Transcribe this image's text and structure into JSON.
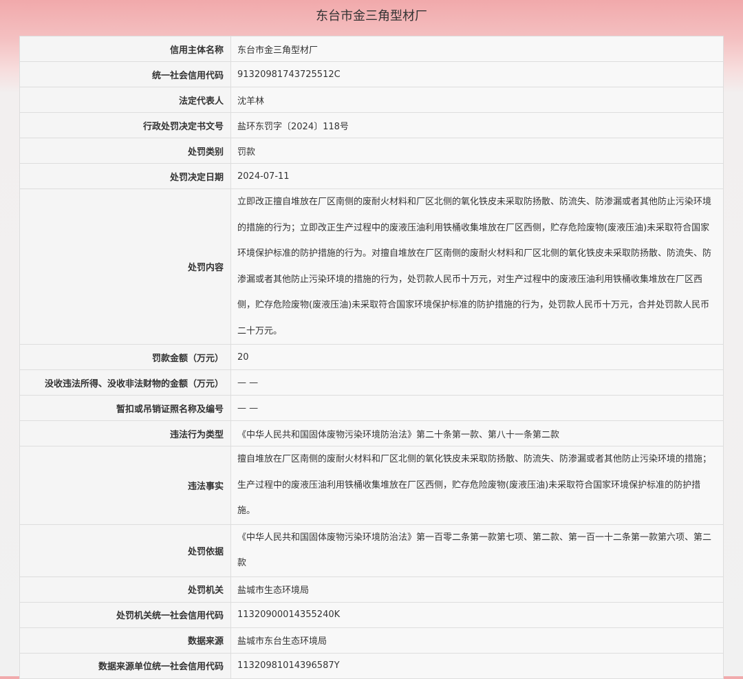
{
  "page": {
    "title": "东台市金三角型材厂"
  },
  "rows": [
    {
      "label": "信用主体名称",
      "value": "东台市金三角型材厂"
    },
    {
      "label": "统一社会信用代码",
      "value": "91320981743725512C"
    },
    {
      "label": "法定代表人",
      "value": "沈羊林"
    },
    {
      "label": "行政处罚决定书文号",
      "value": "盐环东罚字〔2024〕118号"
    },
    {
      "label": "处罚类别",
      "value": "罚款"
    },
    {
      "label": "处罚决定日期",
      "value": "2024-07-11"
    },
    {
      "label": "处罚内容",
      "value": "立即改正擅自堆放在厂区南侧的废耐火材料和厂区北侧的氧化铁皮未采取防扬散、防流失、防渗漏或者其他防止污染环境的措施的行为；立即改正生产过程中的废液压油利用铁桶收集堆放在厂区西侧，贮存危险废物(废液压油)未采取符合国家环境保护标准的防护措施的行为。对擅自堆放在厂区南侧的废耐火材料和厂区北侧的氧化铁皮未采取防扬散、防流失、防渗漏或者其他防止污染环境的措施的行为，处罚款人民币十万元，对生产过程中的废液压油利用铁桶收集堆放在厂区西侧，贮存危险废物(废液压油)未采取符合国家环境保护标准的防护措施的行为，处罚款人民币十万元，合并处罚款人民币二十万元。"
    },
    {
      "label": "罚款金额（万元）",
      "value": "20"
    },
    {
      "label": "没收违法所得、没收非法财物的金额（万元）",
      "value": "— —"
    },
    {
      "label": "暂扣或吊销证照名称及编号",
      "value": "— —"
    },
    {
      "label": "违法行为类型",
      "value": "《中华人民共和国固体废物污染环境防治法》第二十条第一款、第八十一条第二款"
    },
    {
      "label": "违法事实",
      "value": "擅自堆放在厂区南侧的废耐火材料和厂区北侧的氧化铁皮未采取防扬散、防流失、防渗漏或者其他防止污染环境的措施；生产过程中的废液压油利用铁桶收集堆放在厂区西侧，贮存危险废物(废液压油)未采取符合国家环境保护标准的防护措施。"
    },
    {
      "label": "处罚依据",
      "value": "《中华人民共和国固体废物污染环境防治法》第一百零二条第一款第七项、第二款、第一百一十二条第一款第六项、第二款"
    },
    {
      "label": "处罚机关",
      "value": "盐城市生态环境局"
    },
    {
      "label": "处罚机关统一社会信用代码",
      "value": "11320900014355240K"
    },
    {
      "label": "数据来源",
      "value": "盐城市东台生态环境局"
    },
    {
      "label": "数据来源单位统一社会信用代码",
      "value": "11320981014396587Y"
    }
  ]
}
